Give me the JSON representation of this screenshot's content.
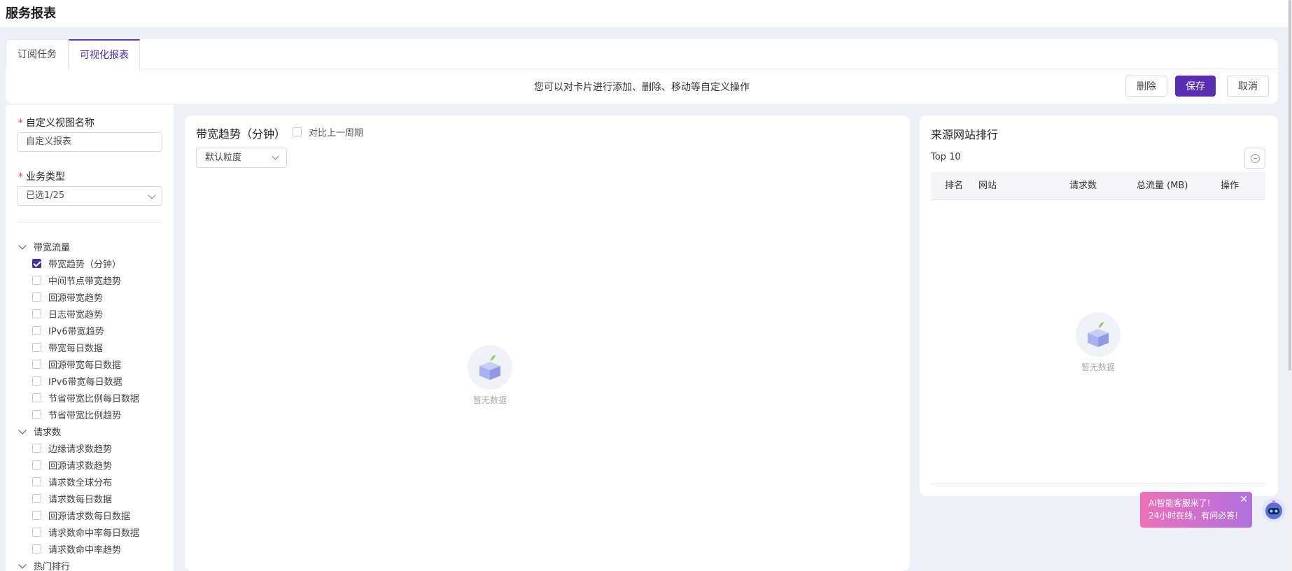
{
  "page": {
    "title": "服务报表"
  },
  "tabs": [
    {
      "label": "订阅任务",
      "active": false
    },
    {
      "label": "可视化报表",
      "active": true
    }
  ],
  "toolbar": {
    "hint": "您可以对卡片进行添加、删除、移动等自定义操作",
    "delete_label": "删除",
    "save_label": "保存",
    "cancel_label": "取消"
  },
  "sidebar": {
    "view_name_label": "自定义视图名称",
    "view_name_value": "自定义报表",
    "business_type_label": "业务类型",
    "business_type_value": "已选1/25",
    "required_mark": "*",
    "groups": [
      {
        "label": "带宽流量",
        "items": [
          {
            "label": "带宽趋势（分钟）",
            "checked": true
          },
          {
            "label": "中间节点带宽趋势",
            "checked": false
          },
          {
            "label": "回源带宽趋势",
            "checked": false
          },
          {
            "label": "日志带宽趋势",
            "checked": false
          },
          {
            "label": "IPv6带宽趋势",
            "checked": false
          },
          {
            "label": "带宽每日数据",
            "checked": false
          },
          {
            "label": "回源带宽每日数据",
            "checked": false
          },
          {
            "label": "IPv6带宽每日数据",
            "checked": false
          },
          {
            "label": "节省带宽比例每日数据",
            "checked": false
          },
          {
            "label": "节省带宽比例趋势",
            "checked": false
          }
        ]
      },
      {
        "label": "请求数",
        "items": [
          {
            "label": "边缘请求数趋势",
            "checked": false
          },
          {
            "label": "回源请求数趋势",
            "checked": false
          },
          {
            "label": "请求数全球分布",
            "checked": false
          },
          {
            "label": "请求数每日数据",
            "checked": false
          },
          {
            "label": "回源请求数每日数据",
            "checked": false
          },
          {
            "label": "请求数命中率每日数据",
            "checked": false
          },
          {
            "label": "请求数命中率趋势",
            "checked": false
          }
        ]
      },
      {
        "label": "热门排行",
        "items": []
      }
    ]
  },
  "bandwidth_card": {
    "title": "带宽趋势（分钟）",
    "compare_label": "对比上一周期",
    "granularity_value": "默认粒度",
    "empty_text": "暂无数据"
  },
  "source_rank_card": {
    "title": "来源网站排行",
    "top_label": "Top 10",
    "columns": [
      "排名",
      "网站",
      "请求数",
      "总流量 (MB)",
      "操作"
    ],
    "rows": [],
    "empty_text": "暂无数据"
  },
  "ai_assistant": {
    "line1": "AI智能客服来了!",
    "line2": "24小时在线，有问必答!",
    "close": "✕"
  },
  "colors": {
    "primary": "#5a2eb3",
    "required": "#e54545",
    "background": "#eff0f6"
  }
}
